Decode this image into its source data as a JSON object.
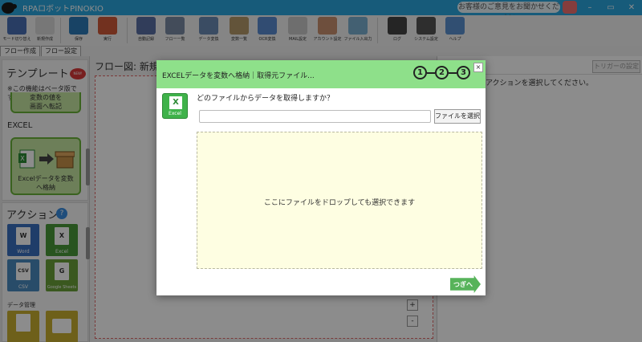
{
  "app": {
    "title": "RPAロボットPINOKIO"
  },
  "feedback": {
    "label": "お客様のご意見をお聞かせください"
  },
  "window_controls": {
    "minimize": "–",
    "maximize": "▭",
    "close": "✕"
  },
  "toolbar": [
    {
      "label": "モード切り替え",
      "color": "#4a6fb5"
    },
    {
      "label": "新規作成",
      "color": "#d9d9d9"
    },
    {
      "label": "保存",
      "color": "#2d7ab8"
    },
    {
      "label": "実行",
      "color": "#d05a3a"
    },
    {
      "label": "自動記録",
      "color": "#5a6fa5"
    },
    {
      "label": "フロー一覧",
      "color": "#7a8aa5"
    },
    {
      "label": "データ変換",
      "color": "#6a8ab5"
    },
    {
      "label": "変数一覧",
      "color": "#b59a6a"
    },
    {
      "label": "OCR変換",
      "color": "#5a8ad0"
    },
    {
      "label": "MAIL設定",
      "color": "#c9c9c9"
    },
    {
      "label": "アカウント設定",
      "color": "#c99070"
    },
    {
      "label": "ファイル入出力",
      "color": "#7ab0d0"
    },
    {
      "label": "ログ",
      "color": "#444"
    },
    {
      "label": "システム設定",
      "color": "#555"
    },
    {
      "label": "ヘルプ",
      "color": "#5a90d0"
    }
  ],
  "tabs": [
    "フロー作成",
    "フロー設定"
  ],
  "templates": {
    "title": "テンプレート",
    "badge": "NEW!",
    "beta_note": "※この機能はベータ版です。",
    "partial_card_lines": [
      "変数の値を",
      "画面へ転記"
    ],
    "section": "EXCEL",
    "card_label_lines": [
      "Excelデータを変数",
      "へ格納"
    ]
  },
  "actions": {
    "title": "アクション",
    "help": "?",
    "tiles": [
      {
        "label": "Word",
        "glyph": "W",
        "color": "#3a6fc0"
      },
      {
        "label": "Excel",
        "glyph": "X",
        "color": "#4a9a3a"
      },
      {
        "label": "CSV",
        "glyph": "CSV",
        "color": "#4a8ac0"
      },
      {
        "label": "Google Sheets",
        "glyph": "G",
        "color": "#6aa03a"
      }
    ],
    "data_mgmt_label": "データ管理",
    "data_tiles": [
      {
        "color": "#c9b030"
      },
      {
        "color": "#c9b030"
      }
    ]
  },
  "flow": {
    "label": "フロー図:  新規"
  },
  "zoom": {
    "plus": "+",
    "minus": "-"
  },
  "right_panel": {
    "trigger_button": "トリガーの設定",
    "message": "アクションを選択してください。"
  },
  "modal": {
    "title": "EXCELデータを変数へ格納｜取得元ファイル...",
    "steps": [
      "1",
      "2",
      "3"
    ],
    "close": "×",
    "icon_label": "Excel",
    "question": "どのファイルからデータを取得しますか？",
    "file_input_value": "",
    "file_button": "ファイルを選択",
    "drop_text": "ここにファイルをドロップしても選択できます",
    "next_button": "つぎへ"
  },
  "colors": {
    "titlebar": "#2aa7de",
    "modal_header": "#8ee08a",
    "template_card": "#c6e7a3",
    "drop_zone": "#fefee2"
  }
}
